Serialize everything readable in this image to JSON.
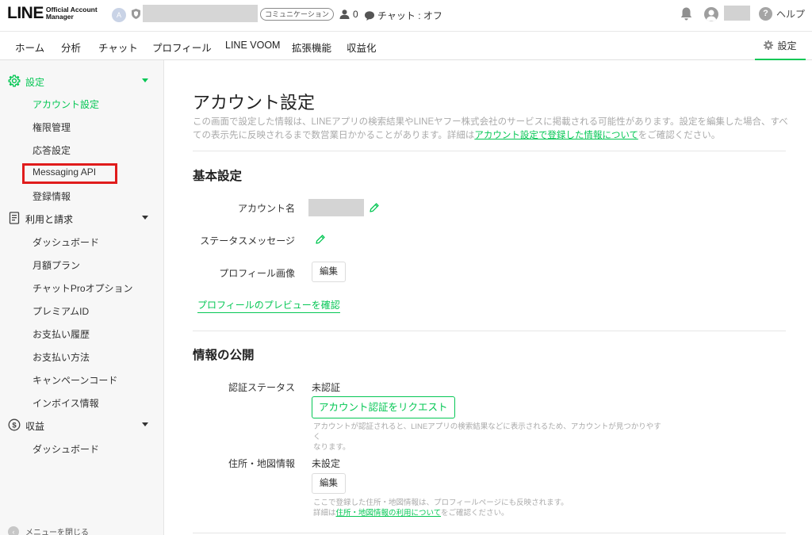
{
  "header": {
    "logo_main": "LINE",
    "logo_sub_1": "Official Account",
    "logo_sub_2": "Manager",
    "account_avatar_letter": "A",
    "account_type_badge": "コミュニケーション",
    "friend_count": "0",
    "chat_status": "チャット : オフ",
    "help_label": "ヘルプ",
    "help_glyph": "?"
  },
  "nav": {
    "tabs": [
      {
        "label": "ホーム"
      },
      {
        "label": "分析"
      },
      {
        "label": "チャット"
      },
      {
        "label": "プロフィール"
      },
      {
        "label": "LINE VOOM"
      },
      {
        "label": "拡張機能"
      },
      {
        "label": "収益化"
      }
    ],
    "settings_label": "設定"
  },
  "sidebar": {
    "sections": [
      {
        "label": "設定",
        "icon": "gear-icon",
        "items": [
          {
            "label": "アカウント設定",
            "active": true
          },
          {
            "label": "権限管理"
          },
          {
            "label": "応答設定"
          },
          {
            "label": "Messaging API",
            "highlighted": true
          },
          {
            "label": "登録情報"
          }
        ]
      },
      {
        "label": "利用と請求",
        "icon": "billing-document-icon",
        "items": [
          {
            "label": "ダッシュボード"
          },
          {
            "label": "月額プラン"
          },
          {
            "label": "チャットProオプション"
          },
          {
            "label": "プレミアムID"
          },
          {
            "label": "お支払い履歴"
          },
          {
            "label": "お支払い方法"
          },
          {
            "label": "キャンペーンコード"
          },
          {
            "label": "インボイス情報"
          }
        ]
      },
      {
        "label": "収益",
        "icon": "dollar-coin-icon",
        "items": [
          {
            "label": "ダッシュボード"
          }
        ]
      }
    ],
    "close_menu_label": "メニューを閉じる",
    "close_menu_glyph": "‹"
  },
  "main": {
    "title": "アカウント設定",
    "description_prefix": "この画面で設定した情報は、LINEアプリの検索結果やLINEヤフー株式会社のサービスに掲載される可能性があります。設定を編集した場合、すべての表示先に反映されるまで数営業日かかることがあります。詳細は",
    "description_link": "アカウント設定で登録した情報について",
    "description_suffix": "をご確認ください。",
    "basic": {
      "title": "基本設定",
      "account_name_label": "アカウント名",
      "status_message_label": "ステータスメッセージ",
      "profile_image_label": "プロフィール画像",
      "edit_label": "編集",
      "preview_link": "プロフィールのプレビューを確認"
    },
    "public": {
      "title": "情報の公開",
      "verification_label": "認証ステータス",
      "verification_value": "未認証",
      "request_button": "アカウント認証をリクエスト",
      "verification_note_1": "アカウントが認証されると、LINEアプリの検索結果などに表示されるため、アカウントが見つかりやすく",
      "verification_note_2": "なります。",
      "address_label": "住所・地図情報",
      "address_value": "未設定",
      "edit_label": "編集",
      "address_note_1": "ここで登録した住所・地図情報は、プロフィールページにも反映されます。",
      "address_note_2_prefix": "詳細は",
      "address_note_2_link": "住所・地図情報の利用について",
      "address_note_2_suffix": "をご確認ください。"
    }
  },
  "colors": {
    "accent": "#06c755",
    "highlight_box": "#e01c1c",
    "sidebar_bg": "#f7f7f7"
  }
}
